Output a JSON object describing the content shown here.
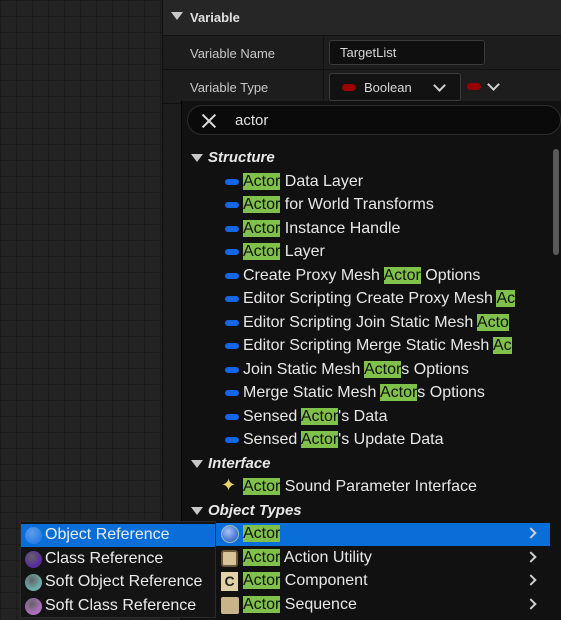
{
  "details": {
    "section_title": "Variable",
    "name_label": "Variable Name",
    "name_value": "TargetList",
    "type_label": "Variable Type",
    "type_value": "Boolean",
    "type_color": "#9a0000"
  },
  "picker": {
    "search_value": "actor",
    "highlight_color": "#7fc14a",
    "selection_color": "#0a6ed8",
    "categories": {
      "structure": "Structure",
      "interface": "Interface",
      "object_types": "Object Types"
    },
    "structure_items": [
      {
        "pre": "",
        "hl": "Actor",
        "post": " Data Layer"
      },
      {
        "pre": "",
        "hl": "Actor",
        "post": " for World Transforms"
      },
      {
        "pre": "",
        "hl": "Actor",
        "post": " Instance Handle"
      },
      {
        "pre": "",
        "hl": "Actor",
        "post": " Layer"
      },
      {
        "pre": "Create Proxy Mesh ",
        "hl": "Actor",
        "post": " Options"
      },
      {
        "pre": "Editor Scripting Create Proxy Mesh ",
        "hl": "Ac",
        "post": ""
      },
      {
        "pre": "Editor Scripting Join Static Mesh ",
        "hl": "Acto",
        "post": ""
      },
      {
        "pre": "Editor Scripting Merge Static Mesh ",
        "hl": "Ac",
        "post": ""
      },
      {
        "pre": "Join Static Mesh ",
        "hl": "Actor",
        "post": "s Options"
      },
      {
        "pre": "Merge Static Mesh ",
        "hl": "Actor",
        "post": "s Options"
      },
      {
        "pre": "Sensed ",
        "hl": "Actor",
        "post": "'s Data"
      },
      {
        "pre": "Sensed ",
        "hl": "Actor",
        "post": "'s Update Data"
      }
    ],
    "interface_items": [
      {
        "pre": "",
        "hl": "Actor",
        "post": " Sound Parameter Interface",
        "icon": "sparkle-icon"
      }
    ],
    "object_items": [
      {
        "pre": "",
        "hl": "Actor",
        "post": "",
        "icon": "actor-icon",
        "selected": true
      },
      {
        "pre": "",
        "hl": "Actor",
        "post": " Action Utility",
        "icon": "cube-icon"
      },
      {
        "pre": "",
        "hl": "Actor",
        "post": " Component",
        "icon": "component-icon"
      },
      {
        "pre": "",
        "hl": "Actor",
        "post": " Sequence",
        "icon": "sequence-icon"
      }
    ]
  },
  "submenu": {
    "items": [
      {
        "label": "Object Reference",
        "color": "#2f7fe8",
        "selected": true
      },
      {
        "label": "Class Reference",
        "color": "#5a2aa0"
      },
      {
        "label": "Soft Object Reference",
        "color": "#6fb0b0"
      },
      {
        "label": "Soft Class Reference",
        "color": "#b070c0"
      }
    ]
  }
}
